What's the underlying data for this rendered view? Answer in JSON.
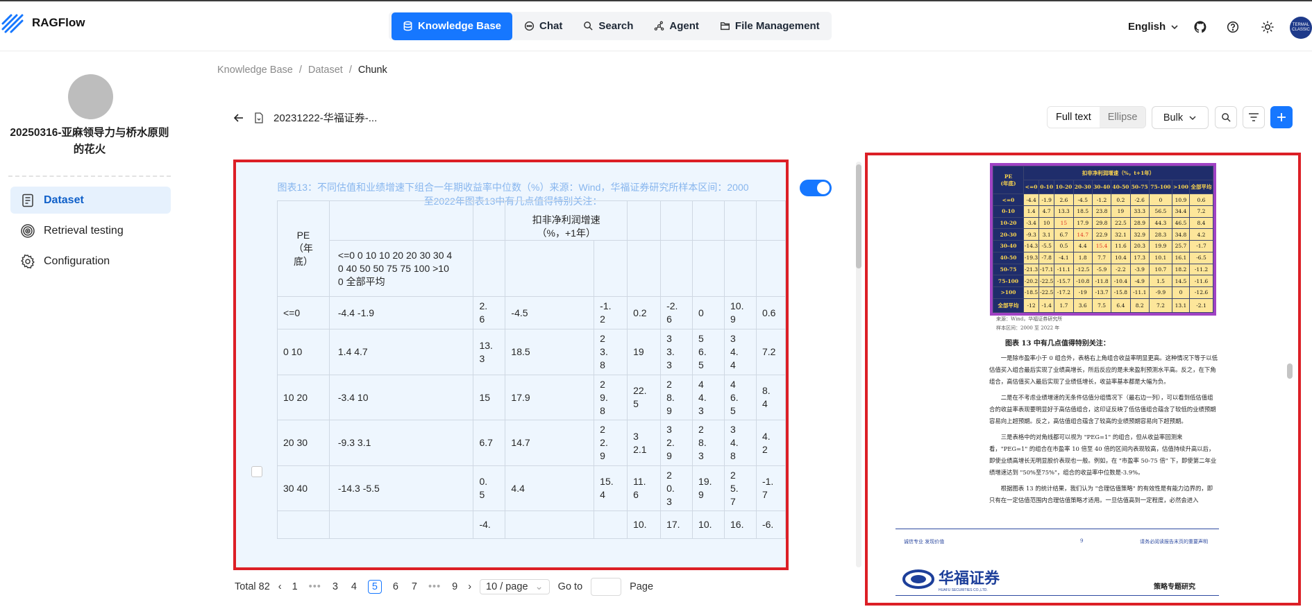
{
  "app": {
    "name": "RAGFlow"
  },
  "nav": {
    "items": [
      "Knowledge Base",
      "Chat",
      "Search",
      "Agent",
      "File Management"
    ],
    "active": "Knowledge Base"
  },
  "header": {
    "language": "English",
    "avatar_text": "TERMAL CLASSIC"
  },
  "sidebar": {
    "kb_name": "20250316-亚麻领导力与桥水原则的花火",
    "items": [
      "Dataset",
      "Retrieval testing",
      "Configuration"
    ],
    "active": "Dataset"
  },
  "breadcrumb": {
    "items": [
      "Knowledge Base",
      "Dataset",
      "Chunk"
    ]
  },
  "doc": {
    "name": "20231222-华福证券-..."
  },
  "toolbar": {
    "full_text": "Full text",
    "ellipse": "Ellipse",
    "bulk": "Bulk"
  },
  "chunk": {
    "caption": "图表13：不同估值和业绩增速下组合一年期收益率中位数（%）来源：Wind，华福证券研究所样本区间：2000至2022年图表13中有几点值得特别关注：",
    "header": {
      "pe": "PE\n（年\n底）",
      "growth": "扣非净利润增速\n（%，+1年）",
      "sub": "<=0 0 10 10 20 20 30 30 4\n0 40 50 50 75 75 100 >10\n0 全部平均"
    },
    "rows": [
      [
        "<=0",
        "-4.4 -1.9",
        "2.\n6",
        "-4.5",
        "-1.\n2",
        "0.2",
        "-2.\n6",
        "0",
        "10.\n9",
        "0.6"
      ],
      [
        "0 10",
        "1.4 4.7",
        "13.\n3",
        "18.5",
        "2\n3.\n8",
        "19",
        "3\n3.\n3",
        "5\n6.\n5",
        "3\n4.\n4",
        "7.2"
      ],
      [
        "10 20",
        "-3.4 10",
        "15",
        "17.9",
        "2\n9.\n8",
        "22.\n5",
        "2\n8.\n9",
        "4\n4.\n3",
        "4\n6.\n5",
        "8.\n4"
      ],
      [
        "20 30",
        "-9.3 3.1",
        "6.7",
        "14.7",
        "2\n2.\n9",
        "3\n2.1",
        "3\n2.\n9",
        "2\n8.\n3",
        "3\n4.\n8",
        "4.\n2"
      ],
      [
        "30 40",
        "-14.3 -5.5",
        "0.\n5",
        "4.4",
        "15.\n4",
        "11.\n6",
        "2\n0.\n3",
        "19.\n9",
        "2\n5.\n7",
        "-1.\n7"
      ],
      [
        "",
        "",
        "-4.",
        "",
        "",
        "10.",
        "17.",
        "10.",
        "16.",
        "-6."
      ]
    ]
  },
  "pagination": {
    "total": "Total 82",
    "pages": [
      "1",
      "•••",
      "3",
      "4",
      "5",
      "6",
      "7",
      "•••",
      "9"
    ],
    "current": "5",
    "page_size": "10 / page",
    "goto": "Go to",
    "page": "Page"
  },
  "preview": {
    "table_header": [
      "PE\n(年底)",
      "扣非净利润增速（%，t+1年）"
    ],
    "cols": [
      "<=0",
      "0-10",
      "10-20",
      "20-30",
      "30-40",
      "40-50",
      "50-75",
      "75-100",
      ">100",
      "全部平均"
    ],
    "rows": [
      [
        "<=0",
        "-4.4",
        "-1.9",
        "2.6",
        "-4.5",
        "-1.2",
        "0.2",
        "-2.6",
        "0",
        "10.9",
        "0.6"
      ],
      [
        "0-10",
        "1.4",
        "4.7",
        "13.3",
        "18.5",
        "23.8",
        "19",
        "33.3",
        "56.5",
        "34.4",
        "7.2"
      ],
      [
        "10-20",
        "-3.4",
        "10",
        "15",
        "17.9",
        "29.8",
        "22.5",
        "28.9",
        "44.3",
        "46.5",
        "8.4"
      ],
      [
        "20-30",
        "-9.3",
        "3.1",
        "6.7",
        "14.7",
        "22.9",
        "32.1",
        "32.9",
        "28.3",
        "34.8",
        "4.2"
      ],
      [
        "30-40",
        "-14.3",
        "-5.5",
        "0.5",
        "4.4",
        "15.4",
        "11.6",
        "20.3",
        "19.9",
        "25.7",
        "-1.7"
      ],
      [
        "40-50",
        "-19.3",
        "-7.8",
        "-4.1",
        "1.8",
        "7.7",
        "10.4",
        "17.3",
        "10.1",
        "16.1",
        "-6.5"
      ],
      [
        "50-75",
        "-21.3",
        "-17.1",
        "-11.1",
        "-12.5",
        "-5.9",
        "-2.2",
        "-3.9",
        "10.7",
        "18.2",
        "-11.2"
      ],
      [
        "75-100",
        "-20.2",
        "-22.5",
        "-15.7",
        "-10.8",
        "-11.8",
        "-10.4",
        "-4.9",
        "1.5",
        "14.5",
        "-11.6"
      ],
      [
        ">100",
        "-18.5",
        "-22.5",
        "-17.2",
        "-19",
        "-13.7",
        "-15.8",
        "-11.1",
        "-9.9",
        "0",
        "-12.6"
      ],
      [
        "全部平均",
        "-12",
        "-1.4",
        "1.7",
        "3.6",
        "7.5",
        "6.4",
        "8.2",
        "7.2",
        "13.1",
        "-2.1"
      ]
    ],
    "source": "来源：Wind，华福证券研究所",
    "range": "样本区间：2000 至 2022 年",
    "section_title": "图表 13 中有几点值得特别关注：",
    "paragraphs": [
      "一是除市盈率小于 0 组合外，表格右上角组合收益率明显更高。这种情况下等于以低估值买入组合最后实现了业绩高增长，所后反应的是未来盈利预测水平高。反之，在下角组合，高估值买入最后实现了业绩低增长，收益率基本都是大幅为负。",
      "二是在不考虑业绩增速的无条件估值分组情况下（最右边一列），可以看到低估值组合的收益率表现要明显好于高估值组合，这印证反映了低估值组合蕴含了较低的业绩预期容易向上超预期。反之，高估值组合蕴含了较高的业绩预期容易向下超预期。",
      "三是表格中的对角线都可以视为 \"PEG=1\" 的组合，但从收益率回测来看，\"PEG=1\" 的组合在市盈率 10 倍至 40 倍的区间内表现较高，估值持续升高以后，即使业绩高增长无明显股价表现也一般。例如，在 \"市盈率 50-75 倍\" 下，即使第二年业绩增速达到 \"50%至75%\"，组合的收益率中位数是-3.9%。",
      "根据图表 13 的统计结果，我们认为 \"合理估值策略\" 的有效性是有能力边界的，即只有在一定估值范围内合理估值策略才适用。一旦估值高到一定程度，必然会进入"
    ],
    "footer_left": "诚信专业  发现价值",
    "footer_page": "9",
    "footer_right": "请务必阅读报告末页的重要声明",
    "brand": "华福证券",
    "brand_en": "HUAFU SECURITIES CO.,LTD.",
    "report_type": "策略专题研究"
  },
  "colors": {
    "accent": "#1677ff",
    "highlight_box": "#dc1f26",
    "chunk_box": "#a042c4"
  }
}
